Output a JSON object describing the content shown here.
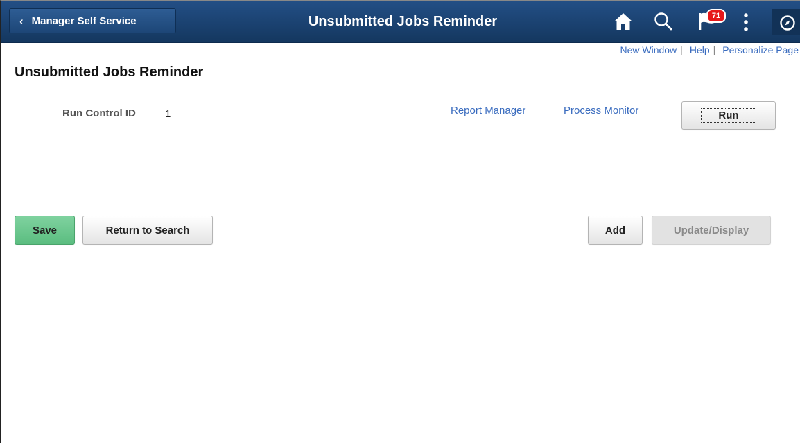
{
  "header": {
    "back_label": "Manager Self Service",
    "title": "Unsubmitted Jobs Reminder",
    "notification_count": "71",
    "icons": [
      "home-icon",
      "search-icon",
      "flag-icon",
      "more-options-icon",
      "navbar-compass-icon"
    ]
  },
  "toplinks": {
    "new_window": "New Window",
    "help": "Help",
    "personalize": "Personalize Page",
    "separator": "|"
  },
  "page": {
    "title": "Unsubmitted Jobs Reminder",
    "run_control_label": "Run Control ID",
    "run_control_value": "1"
  },
  "process_links": {
    "report_manager": "Report Manager",
    "process_monitor": "Process Monitor",
    "run": "Run"
  },
  "buttons": {
    "save": "Save",
    "return_to_search": "Return to Search",
    "add": "Add",
    "update_display": "Update/Display"
  },
  "colors": {
    "banner": "#1d4677",
    "link": "#3a6cbf",
    "save_button": "#6cc88e",
    "badge": "#e6181a"
  }
}
